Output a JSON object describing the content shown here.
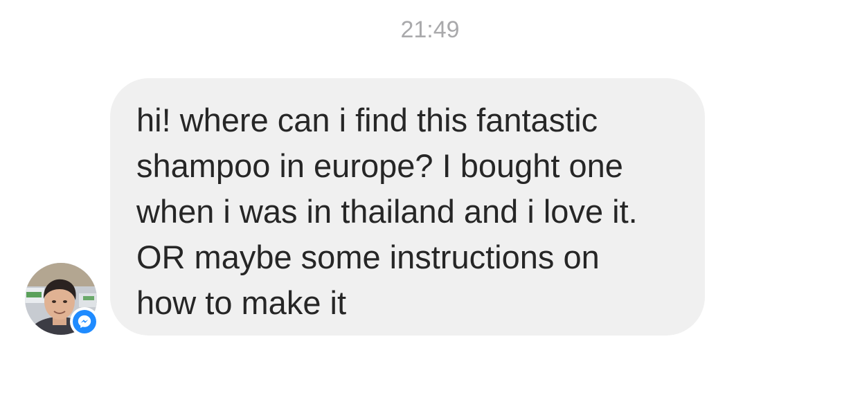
{
  "thread": {
    "timestamp": "21:49"
  },
  "sender": {
    "avatar_icon": "user-photo-avatar",
    "badge_icon": "messenger-icon",
    "badge_color": "#1f8bff"
  },
  "message": {
    "text": "hi! where can i find this fantastic\nshampoo in europe? I bought one\nwhen i was in thailand and i love it.\nOR maybe some instructions on\nhow to make it",
    "bubble_color": "#f0f0f0",
    "text_color": "#262626"
  }
}
